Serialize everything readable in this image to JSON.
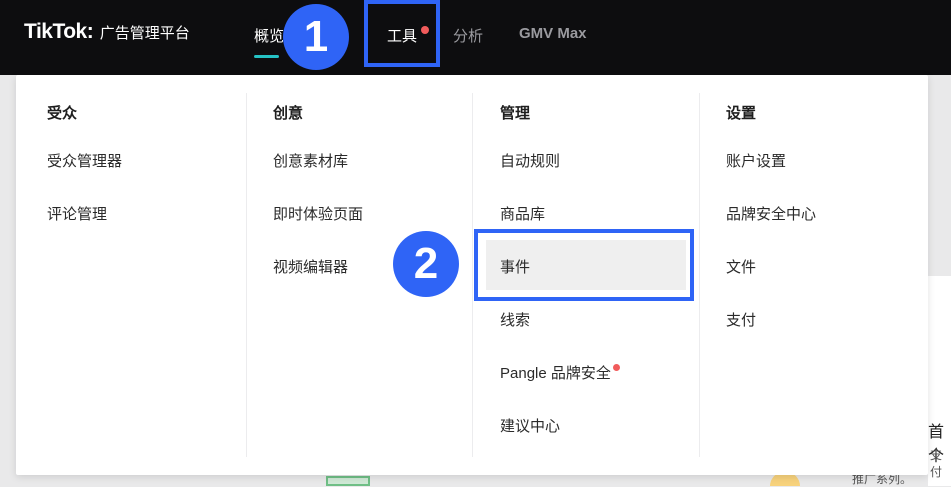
{
  "header": {
    "logo_word": "TikTok",
    "logo_subtitle": "广告管理平台",
    "nav": [
      {
        "label": "概览",
        "active": true
      },
      {
        "label": "工具",
        "active": false,
        "badge": true
      },
      {
        "label": "分析",
        "active": false
      },
      {
        "label": "GMV Max",
        "active": false
      }
    ]
  },
  "markers": {
    "first": "1",
    "second": "2"
  },
  "menu": {
    "columns": [
      {
        "title": "受众",
        "items": [
          {
            "label": "受众管理器"
          },
          {
            "label": "评论管理"
          }
        ]
      },
      {
        "title": "创意",
        "items": [
          {
            "label": "创意素材库"
          },
          {
            "label": "即时体验页面"
          },
          {
            "label": "视频编辑器"
          }
        ]
      },
      {
        "title": "管理",
        "items": [
          {
            "label": "自动规则"
          },
          {
            "label": "商品库"
          },
          {
            "label": "事件",
            "highlighted": true
          },
          {
            "label": "线索"
          },
          {
            "label": "Pangle 品牌安全",
            "badge": true
          },
          {
            "label": "建议中心"
          }
        ]
      },
      {
        "title": "设置",
        "items": [
          {
            "label": "账户设置"
          },
          {
            "label": "品牌安全中心"
          },
          {
            "label": "文件"
          },
          {
            "label": "支付"
          }
        ]
      }
    ]
  },
  "background": {
    "right_title_fragment": "首个",
    "right_line_fragment": "支付",
    "bottom_fragment": "推广系列。"
  },
  "colors": {
    "header_bg": "#0d0d0f",
    "accent_underline": "#25c2c4",
    "annotation_blue": "#2f64f6",
    "badge_red": "#f15b5b"
  }
}
